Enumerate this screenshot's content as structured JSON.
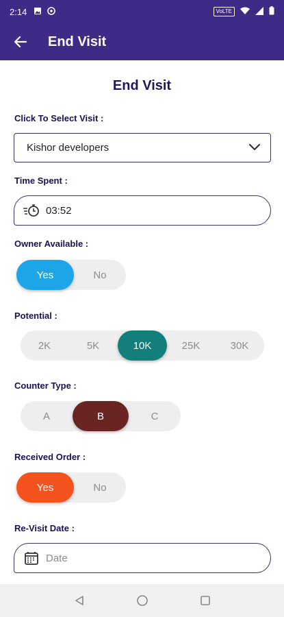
{
  "status_bar": {
    "time": "2:14",
    "network_label": "VoLTE"
  },
  "app_bar": {
    "title": "End Visit"
  },
  "page": {
    "title": "End Visit"
  },
  "visit": {
    "label": "Click To Select Visit :",
    "selected": "Kishor developers"
  },
  "time_spent": {
    "label": "Time Spent :",
    "value": "03:52"
  },
  "owner_available": {
    "label": "Owner Available :",
    "options": [
      "Yes",
      "No"
    ],
    "selected": "Yes",
    "active_color": "#1ca6e8"
  },
  "potential": {
    "label": "Potential :",
    "options": [
      "2K",
      "5K",
      "10K",
      "25K",
      "30K"
    ],
    "selected": "10K",
    "active_color": "#137f7a"
  },
  "counter_type": {
    "label": "Counter Type :",
    "options": [
      "A",
      "B",
      "C"
    ],
    "selected": "B",
    "active_color": "#6b2424"
  },
  "received_order": {
    "label": "Received Order :",
    "options": [
      "Yes",
      "No"
    ],
    "selected": "Yes",
    "active_color": "#f5531e"
  },
  "revisit_date": {
    "label": "Re-Visit Date :",
    "placeholder": "Date"
  },
  "colors": {
    "primary": "#3f2a86",
    "heading": "#23155d"
  }
}
